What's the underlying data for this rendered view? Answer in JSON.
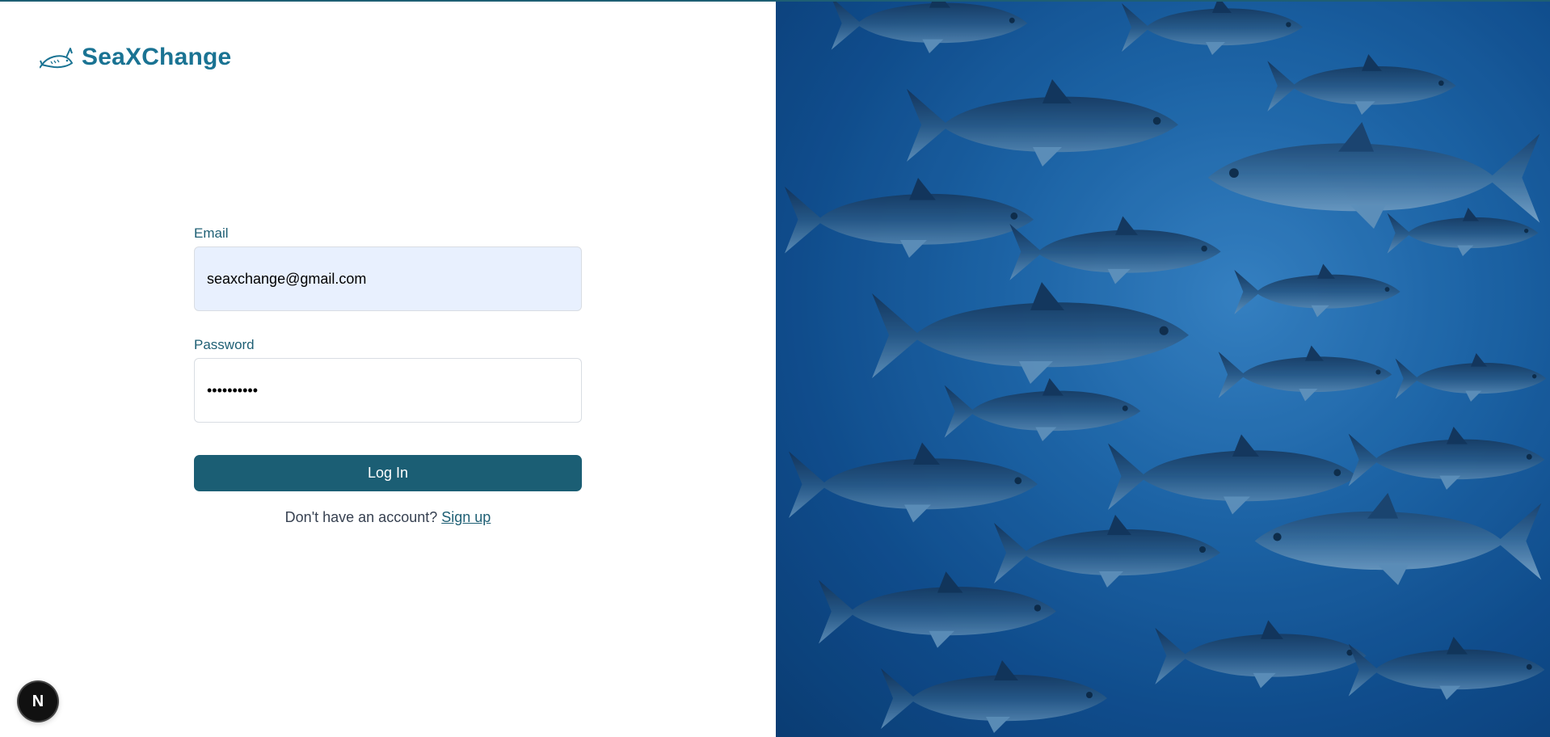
{
  "brand": {
    "name": "SeaXChange",
    "icon": "fish-logo-icon",
    "color": "#1a7393"
  },
  "login_form": {
    "email_label": "Email",
    "email_value": "seaxchange@gmail.com",
    "password_label": "Password",
    "password_value": "••••••••••",
    "submit_label": "Log In",
    "signup_prompt": "Don't have an account?",
    "signup_link": "Sign up"
  },
  "dev_badge": {
    "label": "N",
    "icon": "nextjs-icon"
  },
  "hero_image": {
    "subject": "tuna-school-photo",
    "accent_color": "#1f67aa"
  },
  "colors": {
    "primary": "#1b5e74",
    "autofill_bg": "#e8f0fe",
    "label": "#1e5f74"
  }
}
